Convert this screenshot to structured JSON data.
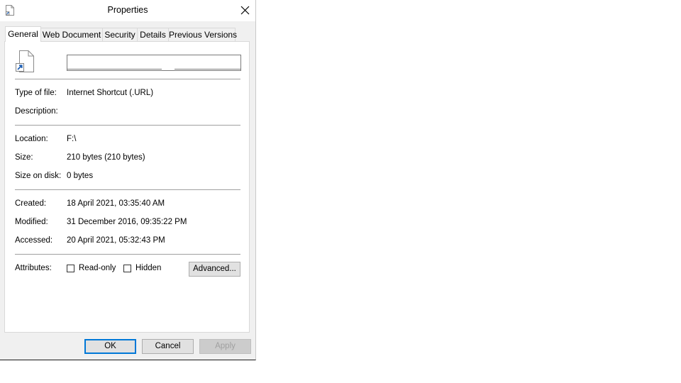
{
  "window": {
    "title": "Properties",
    "close_icon": "close-icon"
  },
  "tabs": [
    {
      "label": "General",
      "active": true
    },
    {
      "label": "Web Document",
      "active": false
    },
    {
      "label": "Security",
      "active": false
    },
    {
      "label": "Details",
      "active": false
    },
    {
      "label": "Previous Versions",
      "active": false
    }
  ],
  "general": {
    "file_icon": "internet-shortcut-file-icon",
    "name_value": "",
    "type_label": "Type of file:",
    "type_value": "Internet Shortcut (.URL)",
    "description_label": "Description:",
    "description_value": "",
    "location_label": "Location:",
    "location_value": "F:\\",
    "size_label": "Size:",
    "size_value": "210 bytes (210 bytes)",
    "size_on_disk_label": "Size on disk:",
    "size_on_disk_value": "0 bytes",
    "created_label": "Created:",
    "created_value": "18 April 2021, 03:35:40 AM",
    "modified_label": "Modified:",
    "modified_value": "31 December 2016, 09:35:22 PM",
    "accessed_label": "Accessed:",
    "accessed_value": "20 April 2021, 05:32:43 PM",
    "attributes_label": "Attributes:",
    "readonly_label": "Read-only",
    "readonly_checked": false,
    "hidden_label": "Hidden",
    "hidden_checked": false,
    "advanced_label": "Advanced..."
  },
  "buttons": {
    "ok_label": "OK",
    "cancel_label": "Cancel",
    "apply_label": "Apply"
  },
  "colors": {
    "accent": "#0078d7",
    "dialog_bg": "#f0f0f0"
  }
}
